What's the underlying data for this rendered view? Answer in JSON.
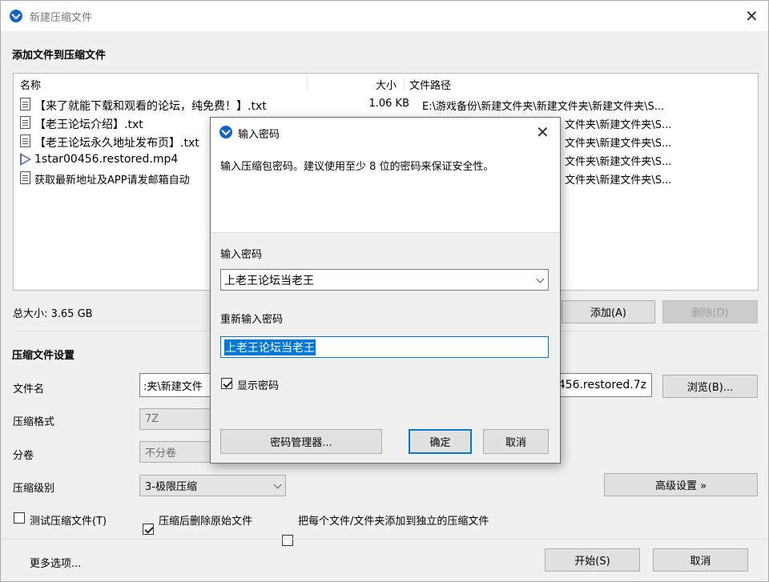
{
  "window": {
    "title": "新建压缩文件",
    "close_glyph": "✕"
  },
  "add_section": {
    "title": "添加文件到压缩文件"
  },
  "file_list": {
    "columns": {
      "name": "名称",
      "size": "大小",
      "path": "文件路径"
    },
    "rows": [
      {
        "name": "【来了就能下载和观看的论坛，纯免费！】.txt",
        "size": "1.06 KB",
        "path": "E:\\游戏备份\\新建文件夹\\新建文件夹\\新建文件夹\\S...",
        "icon": "text-file-icon"
      },
      {
        "name": "【老王论坛介绍】.txt",
        "size": "",
        "path": "文件夹\\新建文件夹\\S...",
        "icon": "text-file-icon"
      },
      {
        "name": "【老王论坛永久地址发布页】.txt",
        "size": "",
        "path": "文件夹\\新建文件夹\\S...",
        "icon": "text-file-icon"
      },
      {
        "name": "1star00456.restored.mp4",
        "size": "",
        "path": "文件夹\\新建文件夹\\S...",
        "icon": "video-file-icon"
      },
      {
        "name": "获取最新地址及APP请发邮箱自动",
        "size": "",
        "path": "文件夹\\新建文件夹\\S...",
        "icon": "text-file-icon"
      }
    ]
  },
  "summary": {
    "total_size": "总大小: 3.65 GB"
  },
  "list_buttons": {
    "add": "添加(A)",
    "delete": "删除(D)"
  },
  "settings": {
    "title": "压缩文件设置",
    "filename_label": "文件名",
    "filename_value_left": ":夹\\新建文件",
    "filename_value_right": "456.restored.7z",
    "browse": "浏览(B)...",
    "format_label": "压缩格式",
    "format_value": "7Z",
    "split_label": "分卷",
    "split_value": "不分卷",
    "level_label": "压缩级别",
    "level_value": "3-极限压缩",
    "advanced": "高级设置 »",
    "test_label": "测试压缩文件(T)",
    "delete_after_label": "压缩后删除原始文件",
    "separate_label": "把每个文件/文件夹添加到独立的压缩文件",
    "test_checked": false,
    "delete_after_checked": true,
    "separate_checked": false
  },
  "footer": {
    "more_options": "更多选项...",
    "more_checked": true,
    "start": "开始(S)",
    "cancel": "取消"
  },
  "dialog": {
    "title": "输入密码",
    "close_glyph": "✕",
    "instruction": "输入压缩包密码。建议使用至少 8 位的密码来保证安全性。",
    "password_label": "输入密码",
    "password_value": "上老王论坛当老王",
    "reenter_label": "重新输入密码",
    "reenter_value": "上老王论坛当老王",
    "show_password_label": "显示密码",
    "show_password_checked": true,
    "manager_button": "密码管理器...",
    "ok_button": "确定",
    "cancel_button": "取消"
  },
  "colors": {
    "accent": "#0078d7",
    "window_bg": "#f0f0f0",
    "app_icon": "#1565c0"
  }
}
